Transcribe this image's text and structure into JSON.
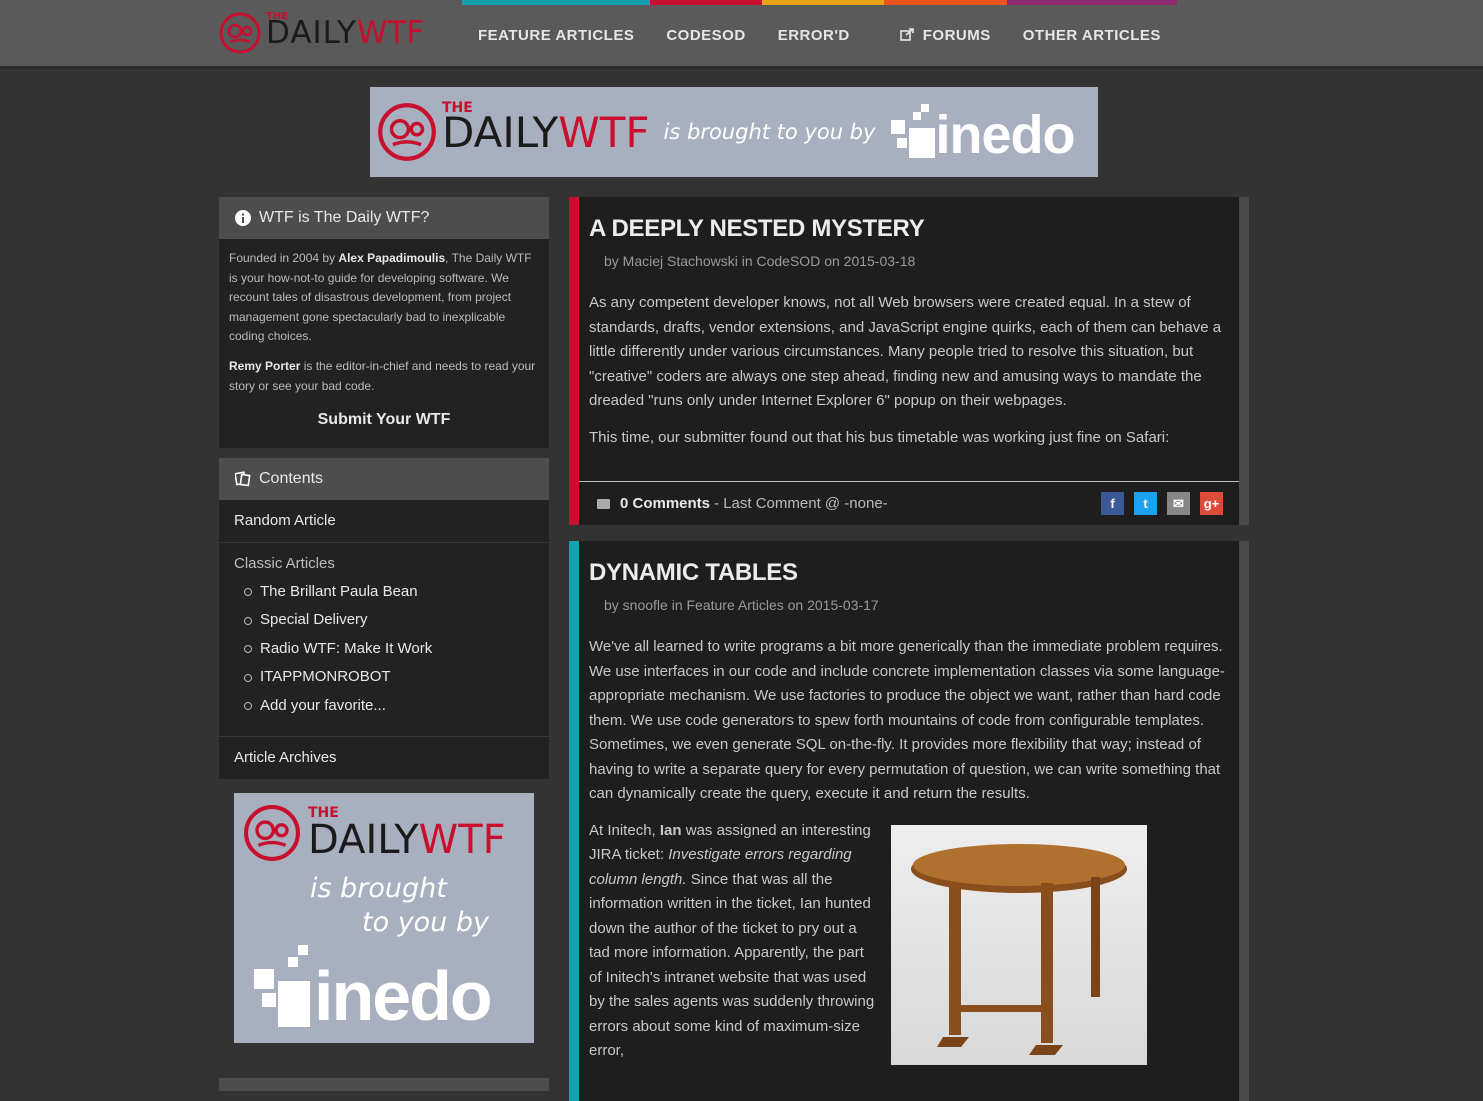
{
  "header": {
    "logo_the": "THE",
    "logo_daily": "DAILY",
    "logo_wtf": "WTF",
    "nav": [
      {
        "label": "FEATURE ARTICLES",
        "color": "#13a3b0"
      },
      {
        "label": "CODESOD",
        "color": "#c8102e"
      },
      {
        "label": "ERROR'D",
        "color": "#e8a317"
      },
      {
        "label": "FORUMS",
        "color": "#e8541a",
        "icon": "external-link-icon"
      },
      {
        "label": "OTHER ARTICLES",
        "color": "#8e2a6e"
      }
    ]
  },
  "banner": {
    "the": "THE",
    "daily": "DAILY",
    "wtf": "WTF",
    "brought": "is brought to you by",
    "sponsor": "inedo"
  },
  "sidebar": {
    "about_title": "WTF is The Daily WTF?",
    "about_p1_pre": "Founded in 2004 by ",
    "about_p1_link": "Alex Papadimoulis",
    "about_p1_post": ", The Daily WTF is your how-not-to guide for developing software. We recount tales of disastrous development, from project management gone spectacularly bad to inexplicable coding choices.",
    "about_p2_link": "Remy Porter",
    "about_p2_post": " is the editor-in-chief and needs to read your story or see your bad code.",
    "submit": "Submit Your WTF",
    "contents_title": "Contents",
    "random": "Random Article",
    "classic_title": "Classic Articles",
    "classic": [
      "The Brillant Paula Bean",
      "Special Delivery",
      "Radio WTF: Make It Work",
      "ITAPPMONROBOT",
      "Add your favorite..."
    ],
    "archives": "Article Archives",
    "ad": {
      "the": "THE",
      "daily": "DAILY",
      "wtf": "WTF",
      "by1": "is brought",
      "by2": "to you by",
      "sponsor": "inedo"
    }
  },
  "articles": [
    {
      "title": "A DEEPLY NESTED MYSTERY",
      "meta": "by Maciej Stachowski in CodeSOD on 2015-03-18",
      "p1": "As any competent developer knows, not all Web browsers were created equal. In a stew of standards, drafts, vendor extensions, and JavaScript engine quirks, each of them can behave a little differently under various circumstances. Many people tried to resolve this situation, but \"creative\" coders are always one step ahead, finding new and amusing ways to mandate the dreaded \"runs only under Internet Explorer 6\" popup on their webpages.",
      "p2": "This time, our submitter found out that his bus timetable was working just fine on Safari:",
      "comments": "0 Comments",
      "last_comment": "- Last Comment @ -none-"
    },
    {
      "title": "DYNAMIC TABLES",
      "meta": "by snoofle in Feature Articles on 2015-03-17",
      "p1": "We've all learned to write programs a bit more generically than the immediate problem requires. We use interfaces in our code and include concrete implementation classes via some language-appropriate mechanism. We use factories to produce the object we want, rather than hard code them. We use code generators to spew forth mountains of code from configurable templates. Sometimes, we even generate SQL on-the-fly. It provides more flexibility that way; instead of having to write a separate query for every permutation of question, we can write something that can dynamically create the query, execute it and return the results.",
      "p2_a": "At Initech, ",
      "p2_name": "Ian",
      "p2_b": " was assigned an interesting JIRA ticket: ",
      "p2_em": "Investigate errors regarding column length.",
      "p2_c": " Since that was all the information written in the ticket, Ian hunted down the author of the ticket to pry out a tad more information. Apparently, the part of Initech's intranet website that was used by the sales agents was suddenly throwing errors about some kind of maximum-size error,"
    }
  ],
  "share": {
    "facebook": "f",
    "twitter": "t",
    "email": "✉",
    "gplus": "g+"
  }
}
